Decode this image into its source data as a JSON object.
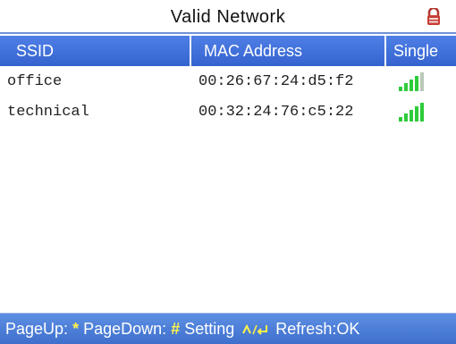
{
  "window": {
    "title": "Valid Network"
  },
  "table": {
    "headers": {
      "ssid": "SSID",
      "mac": "MAC Address",
      "signal": "Single"
    },
    "rows": [
      {
        "ssid": "office",
        "mac": "00:26:67:24:d5:f2",
        "signal_bars": 4,
        "signal_max": 5
      },
      {
        "ssid": "technical",
        "mac": "00:32:24:76:c5:22",
        "signal_bars": 5,
        "signal_max": 5
      }
    ]
  },
  "footer": {
    "pageup_label": "PageUp:",
    "pageup_key": "*",
    "pagedown_label": "PageDown:",
    "pagedown_key": "#",
    "setting_label": "Setting",
    "refresh_label": "Refresh:OK"
  },
  "colors": {
    "header_bg": "#3f6fd9",
    "signal_on": "#2ecc3a",
    "signal_off": "#b9c9b9",
    "footer_key": "#fff34a"
  },
  "icons": {
    "title_right": "lock-icon",
    "signal": "signal-bars-icon",
    "setting_keys": "nav-enter-icon"
  }
}
